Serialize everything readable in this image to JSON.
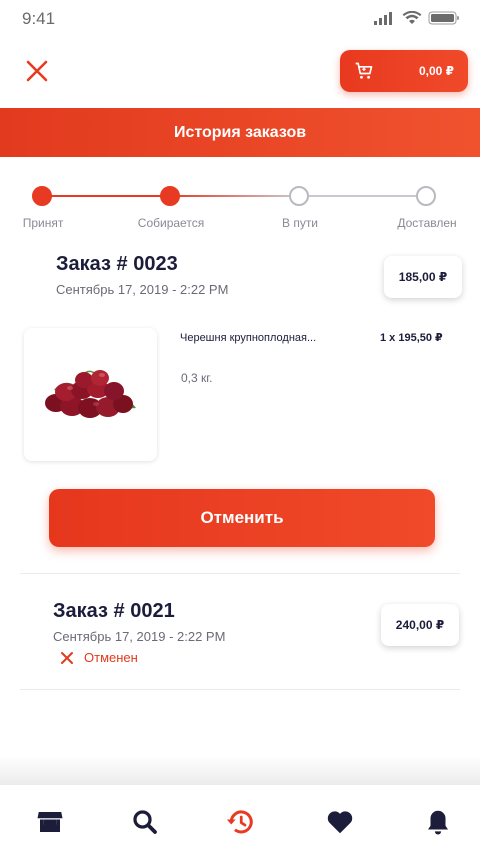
{
  "status_bar": {
    "time": "9:41"
  },
  "header": {
    "close_icon": "close-icon",
    "cart": {
      "icon": "cart-icon",
      "total": "0,00 ₽"
    },
    "title": "История заказов"
  },
  "progress": {
    "steps": [
      {
        "label": "Принят",
        "state": "done"
      },
      {
        "label": "Собирается",
        "state": "done"
      },
      {
        "label": "В пути",
        "state": "pending"
      },
      {
        "label": "Доставлен",
        "state": "pending"
      }
    ]
  },
  "orders": [
    {
      "title": "Заказ # 0023",
      "date": "Сентябрь 17, 2019 - 2:22 PM",
      "price": "185,00 ₽",
      "item": {
        "name": "Черешня крупноплодная...",
        "qty": "1 x 195,50 ₽",
        "weight": "0,3 кг."
      },
      "action": "Отменить"
    },
    {
      "title": "Заказ # 0021",
      "date": "Сентябрь 17, 2019 - 2:22 PM",
      "price": "240,00 ₽",
      "status": "Отменен"
    }
  ],
  "bottom_nav": {
    "items": [
      {
        "icon": "store-icon",
        "active": false
      },
      {
        "icon": "search-icon",
        "active": false
      },
      {
        "icon": "history-icon",
        "active": true
      },
      {
        "icon": "heart-icon",
        "active": false
      },
      {
        "icon": "bell-icon",
        "active": false
      }
    ]
  },
  "colors": {
    "accent": "#e83a22",
    "text": "#1c1d3a",
    "muted": "#6a6a78",
    "inactive": "#b9b9bf"
  }
}
